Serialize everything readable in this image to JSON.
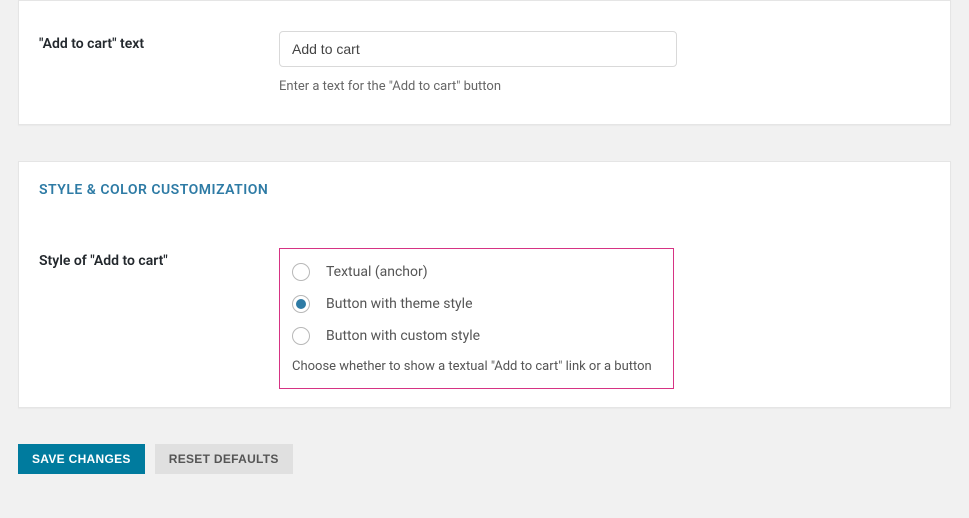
{
  "section1": {
    "field_label": "\"Add to cart\" text",
    "input_value": "Add to cart",
    "help": "Enter a text for the \"Add to cart\" button"
  },
  "section2": {
    "title": "STYLE & COLOR CUSTOMIZATION",
    "field_label": "Style of \"Add to cart\"",
    "options": [
      {
        "label": "Textual (anchor)",
        "selected": false
      },
      {
        "label": "Button with theme style",
        "selected": true
      },
      {
        "label": "Button with custom style",
        "selected": false
      }
    ],
    "help": "Choose whether to show a textual \"Add to cart\" link or a button"
  },
  "actions": {
    "save": "SAVE CHANGES",
    "reset": "RESET DEFAULTS"
  }
}
